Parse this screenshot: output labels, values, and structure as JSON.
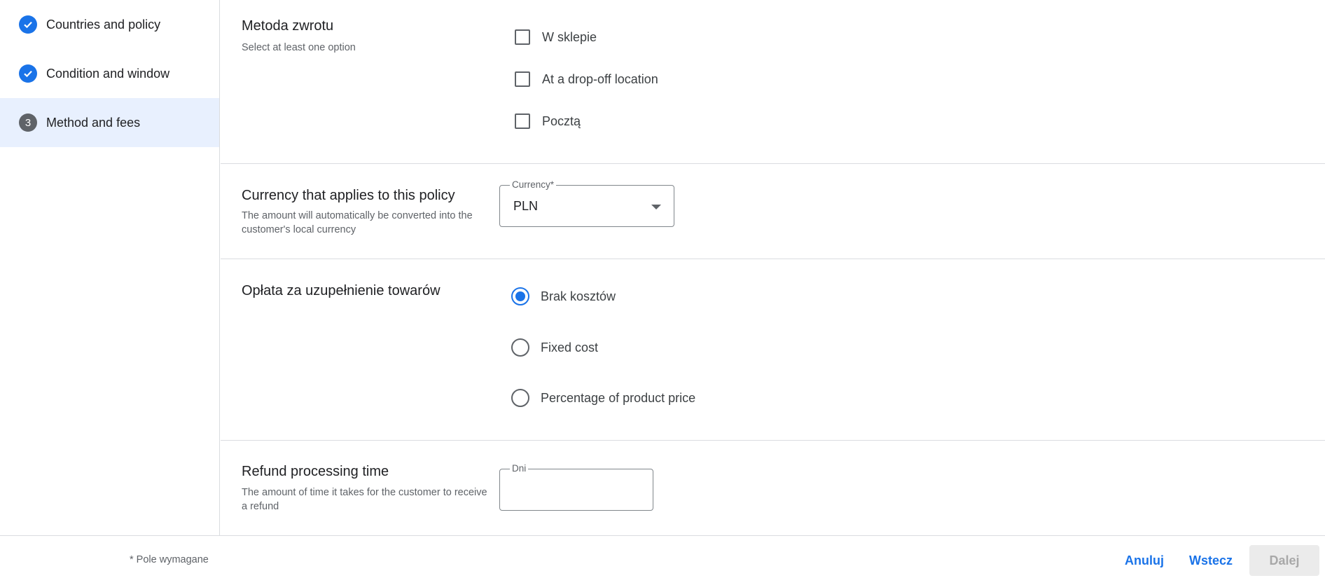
{
  "sidebar": {
    "steps": [
      {
        "label": "Countries and policy",
        "state": "done"
      },
      {
        "label": "Condition and window",
        "state": "done"
      },
      {
        "label": "Method and fees",
        "state": "current",
        "number": "3"
      }
    ]
  },
  "return_method": {
    "title": "Metoda zwrotu",
    "description": "Select at least one option",
    "options": [
      {
        "label": "W sklepie",
        "checked": false
      },
      {
        "label": "At a drop-off location",
        "checked": false
      },
      {
        "label": "Pocztą",
        "checked": false
      }
    ]
  },
  "currency": {
    "title": "Currency that applies to this policy",
    "description": "The amount will automatically be converted into the customer's local currency",
    "field_label": "Currency*",
    "value": "PLN"
  },
  "restocking_fee": {
    "title": "Opłata za uzupełnienie towarów",
    "options": [
      {
        "label": "Brak kosztów",
        "checked": true
      },
      {
        "label": "Fixed cost",
        "checked": false
      },
      {
        "label": "Percentage of product price",
        "checked": false
      }
    ]
  },
  "refund_time": {
    "title": "Refund processing time",
    "description": "The amount of time it takes for the customer to receive a refund",
    "field_label": "Dni",
    "value": ""
  },
  "footer": {
    "required_note": "* Pole wymagane",
    "cancel_label": "Anuluj",
    "back_label": "Wstecz",
    "next_label": "Dalej"
  },
  "colors": {
    "accent": "#1a73e8",
    "active_step_bg": "#e8f0fe",
    "divider": "#dadce0"
  }
}
